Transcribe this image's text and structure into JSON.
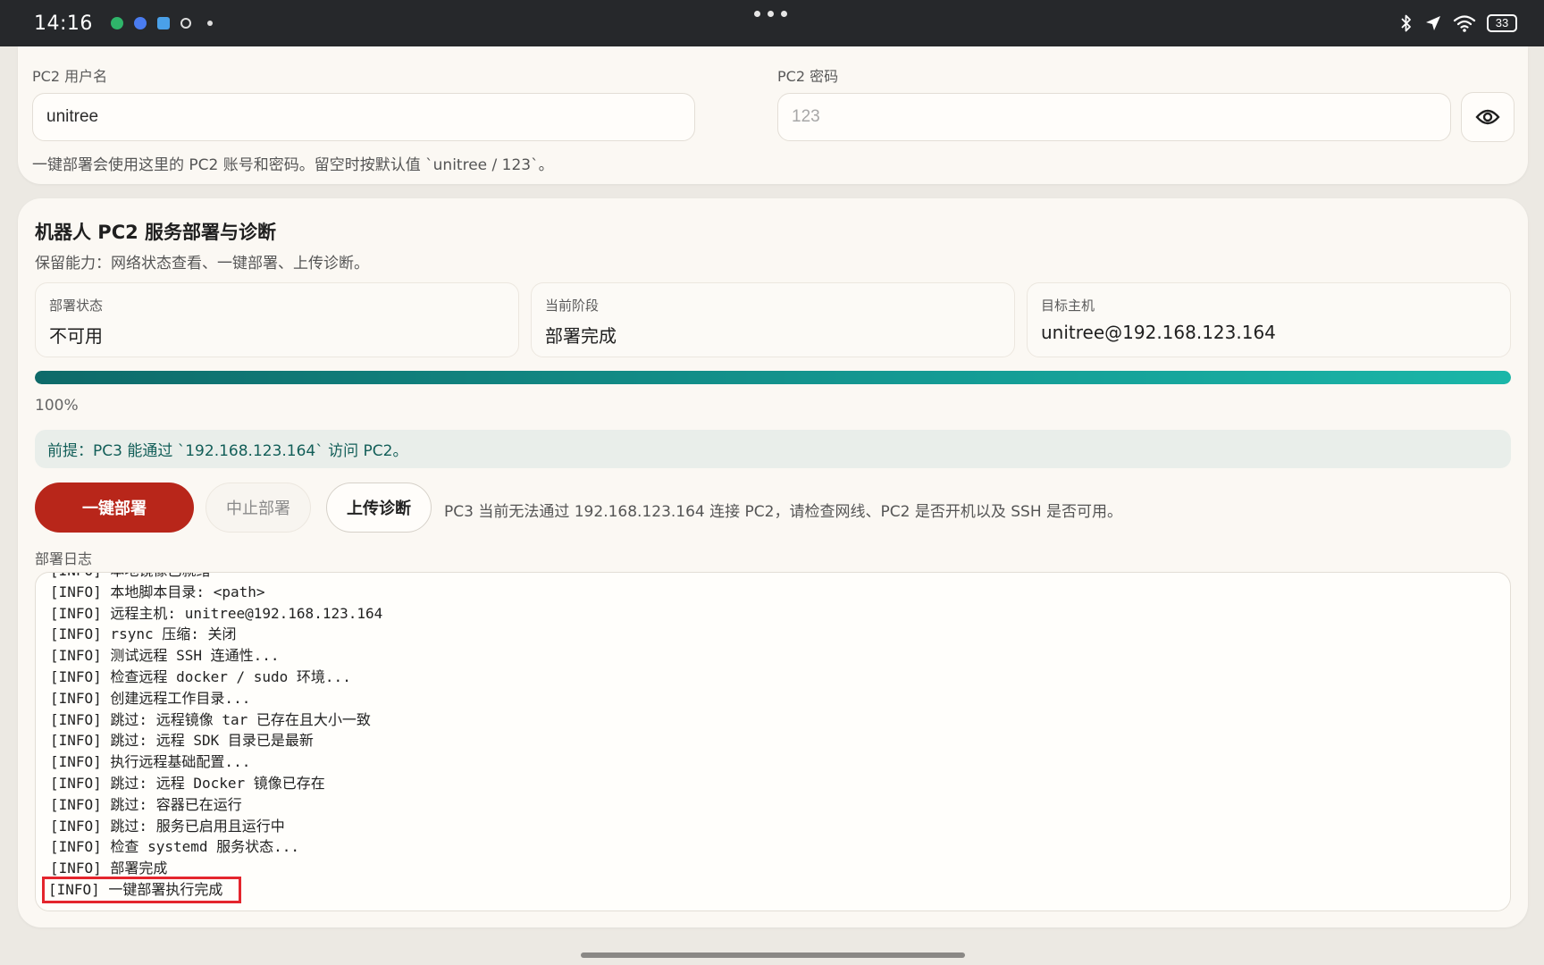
{
  "status_bar": {
    "time": "14:16",
    "battery": "33",
    "notif_colors": [
      "#2fb56a",
      "#4a7cf0",
      "#4aa0e8"
    ]
  },
  "credentials": {
    "username_label": "PC2 用户名",
    "username_value": "unitree",
    "password_label": "PC2 密码",
    "password_placeholder": "123",
    "hint": "一键部署会使用这里的 PC2 账号和密码。留空时按默认值 `unitree / 123`。"
  },
  "deploy": {
    "title": "机器人 PC2 服务部署与诊断",
    "subtitle": "保留能力：网络状态查看、一键部署、上传诊断。",
    "stats": [
      {
        "key": "部署状态",
        "value": "不可用"
      },
      {
        "key": "当前阶段",
        "value": "部署完成"
      },
      {
        "key": "目标主机",
        "value": "unitree@192.168.123.164"
      }
    ],
    "progress_percent": 100,
    "progress_text": "100%",
    "notice": "前提：PC3 能通过 `192.168.123.164` 访问 PC2。",
    "buttons": {
      "deploy": "一键部署",
      "abort": "中止部署",
      "upload": "上传诊断"
    },
    "error_message": "PC3 当前无法通过 192.168.123.164 连接 PC2，请检查网线、PC2 是否开机以及 SSH 是否可用。",
    "log_label": "部署日志",
    "log_lines": [
      "[INFO] 本地镜像已就绪",
      "[INFO] 本地脚本目录: <path>",
      "[INFO] 远程主机: unitree@192.168.123.164",
      "[INFO] rsync 压缩: 关闭",
      "[INFO] 测试远程 SSH 连通性...",
      "[INFO] 检查远程 docker / sudo 环境...",
      "[INFO] 创建远程工作目录...",
      "[INFO] 跳过: 远程镜像 tar 已存在且大小一致",
      "[INFO] 跳过: 远程 SDK 目录已是最新",
      "[INFO] 执行远程基础配置...",
      "[INFO] 跳过: 远程 Docker 镜像已存在",
      "[INFO] 跳过: 容器已在运行",
      "[INFO] 跳过: 服务已启用且运行中",
      "[INFO] 检查 systemd 服务状态...",
      "[INFO] 部署完成",
      "[INFO] 一键部署执行完成"
    ]
  }
}
